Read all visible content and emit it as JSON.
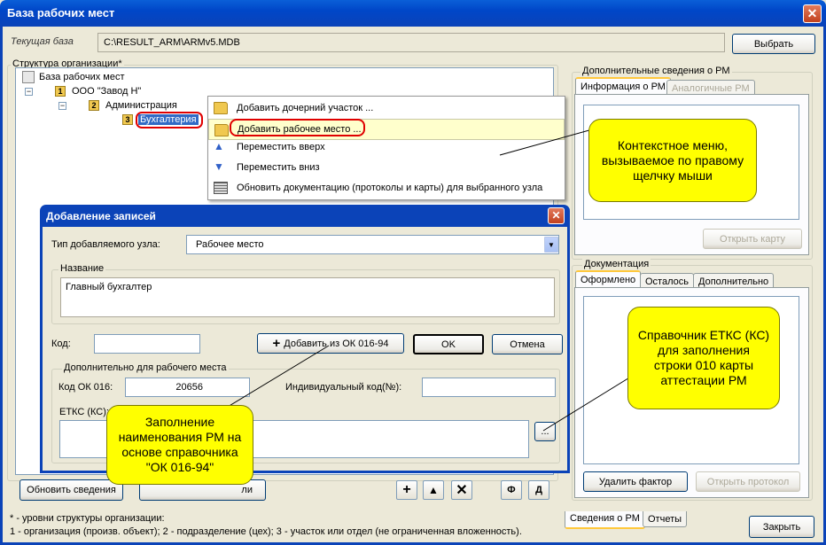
{
  "window": {
    "title": "База рабочих мест",
    "close": "✕"
  },
  "current_db": {
    "label": "Текущая база",
    "value": "C:\\RESULT_ARM\\ARMv5.MDB",
    "button": "Выбрать"
  },
  "tree": {
    "legend": "Структура организации*",
    "root": "База рабочих мест",
    "nodes": [
      {
        "level": "1",
        "label": "ООО \"Завод Н\""
      },
      {
        "level": "2",
        "label": "Администрация"
      },
      {
        "level": "3",
        "label": "Бухгалтерия"
      }
    ]
  },
  "context_menu": {
    "items": [
      {
        "label": "Добавить дочерний участок ...",
        "icon": "folder-icon"
      },
      {
        "label": "Добавить рабочее место ...",
        "icon": "folder-icon"
      },
      {
        "label": "Переместить вверх",
        "icon": "arrow-up-icon"
      },
      {
        "label": "Переместить вниз",
        "icon": "arrow-down-icon"
      },
      {
        "label": "Обновить документацию (протоколы и карты) для выбранного узла",
        "icon": "document-icon"
      }
    ]
  },
  "right_panel": {
    "extra_legend": "Дополнительные сведения о РМ",
    "extra_tabs": [
      "Информация о РМ",
      "Аналогичные РМ"
    ],
    "open_card": "Открыть карту",
    "doc_legend": "Документация",
    "doc_tabs": [
      "Оформлено",
      "Осталось",
      "Дополнительно"
    ],
    "remove_factor": "Удалить фактор",
    "open_protocol": "Открыть протокол"
  },
  "bottom": {
    "refresh": "Обновить сведения",
    "partial": "ли",
    "f_btn": "Ф",
    "d_btn": "Д",
    "note1": "* - уровни структуры организации:",
    "note2": "1 - организация (произв. объект); 2 - подразделение (цех); 3 - участок или отдел (не ограниченная вложенность).",
    "tabs": [
      "Сведения о РМ",
      "Отчеты"
    ],
    "close": "Закрыть"
  },
  "dialog": {
    "title": "Добавление записей",
    "node_type_label": "Тип добавляемого узла:",
    "node_type_value": "Рабочее место",
    "name_legend": "Название",
    "name_value": "Главный бухгалтер",
    "code_label": "Код:",
    "code_value": "",
    "add_from_ok": "Добавить из ОК 016-94",
    "ok": "OK",
    "cancel": "Отмена",
    "extra_legend": "Дополнительно для рабочего места",
    "ok016_label": "Код ОК 016:",
    "ok016_value": "20656",
    "indiv_label": "Индивидуальный код(№):",
    "indiv_value": "",
    "etks_label": "ЕТКС (КС):",
    "etks_value": "",
    "dots": "..."
  },
  "callouts": {
    "context": "Контекстное меню, вызываемое по правому щелчку мыши",
    "etks": "Справочник ЕТКС (КС) для заполнения строки 010 карты аттестации РМ",
    "ok016": "Заполнение наименования РМ на основе справочника \"ОК 016-94\""
  },
  "colors": {
    "titlebar": "#0b43b8",
    "callout": "#ffff00",
    "highlight": "#e00000"
  }
}
